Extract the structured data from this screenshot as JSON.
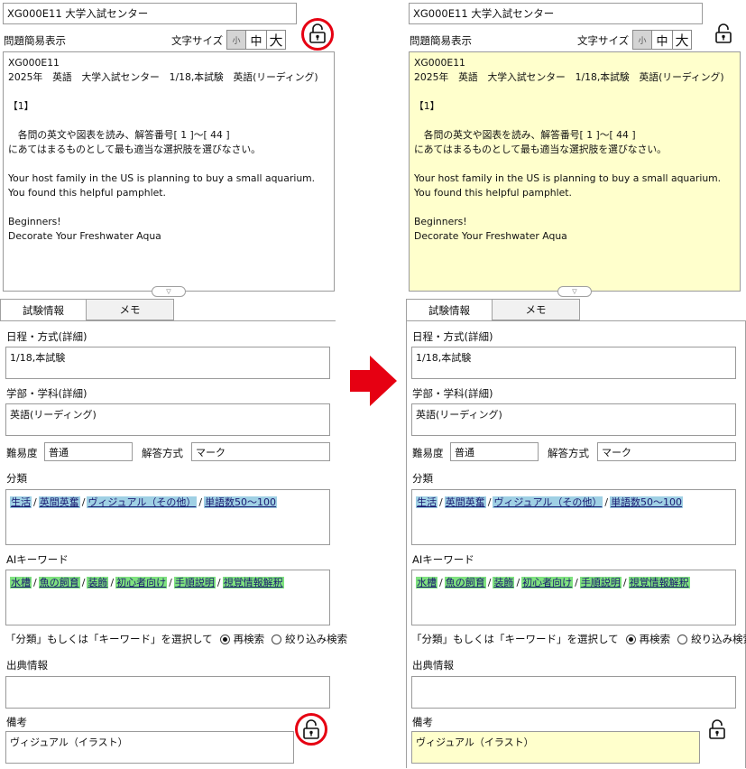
{
  "title_field": "XG000E11 大学入試センター",
  "question_simple_label": "問題簡易表示",
  "font_size_label": "文字サイズ",
  "font_sizes": {
    "small": "小",
    "medium": "中",
    "large": "大"
  },
  "question_lines": [
    "XG000E11",
    "2025年　英語　大学入試センター　1/18,本試験　英語(リーディング)",
    "",
    "【1】",
    "",
    "　各問の英文や図表を読み、解答番号[ 1 ]〜[ 44 ]",
    "にあてはまるものとして最も適当な選択肢を選びなさい。",
    "",
    " Your host family in the US is planning to buy a small aquarium. You found this helpful pamphlet.",
    "",
    "Beginners!",
    "Decorate Your Freshwater Aqua"
  ],
  "tabs": {
    "info": "試験情報",
    "memo": "メモ"
  },
  "fields": {
    "schedule_label": "日程・方式(詳細)",
    "schedule_value": "1/18,本試験",
    "department_label": "学部・学科(詳細)",
    "department_value": "英語(リーディング)",
    "difficulty_label": "難易度",
    "difficulty_value": "普通",
    "answer_method_label": "解答方式",
    "answer_method_value": "マーク",
    "category_label": "分類",
    "category_tags": [
      "生活",
      "英間英奮",
      "ヴィジュアル（その他）",
      "単語数50〜100"
    ],
    "ai_keyword_label": "AIキーワード",
    "ai_keyword_tags": [
      "水槽",
      "魚の飼育",
      "装飾",
      "初心者向け",
      "手順説明",
      "視覚情報解釈"
    ],
    "search_hint": "「分類」もしくは「キーワード」を選択して",
    "radio_research": "再検索",
    "radio_narrow": "絞り込み検索",
    "source_label": "出典情報",
    "source_value": "",
    "remarks_label": "備考",
    "remarks_value": "ヴィジュアル（イラスト）"
  },
  "colors": {
    "highlight_circle": "#e60012",
    "arrow": "#e60012",
    "category_tag_bg": "#9fd0e4",
    "keyword_tag_bg": "#7fe27f",
    "readonly_bg": "#ffffcc"
  },
  "icons": {
    "lock": "unlock-icon",
    "arrow": "right-arrow-icon",
    "splitter": "chevron-down-icon"
  }
}
